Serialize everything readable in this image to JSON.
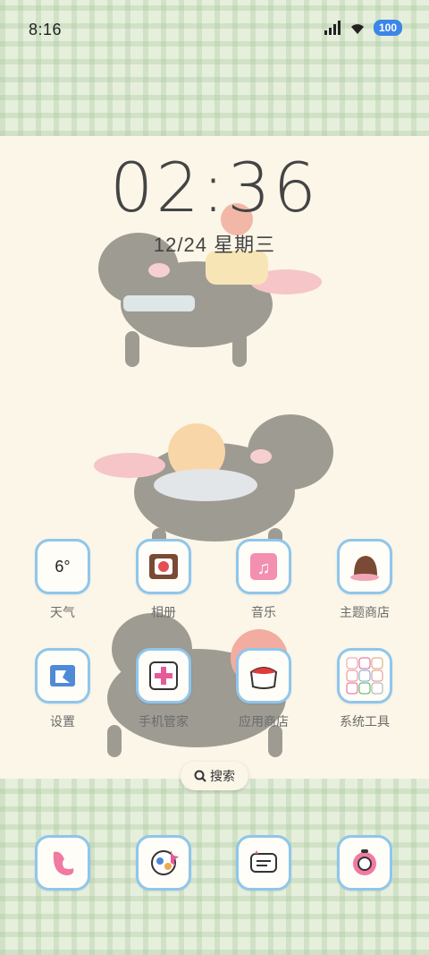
{
  "status_bar": {
    "time": "8:16",
    "battery": "100"
  },
  "clock_widget": {
    "time": "02:36",
    "date": "12/24 星期三"
  },
  "apps_row1": [
    {
      "label": "天气",
      "value": "6°",
      "icon": "weather-icon"
    },
    {
      "label": "相册",
      "icon": "gallery-icon"
    },
    {
      "label": "音乐",
      "icon": "music-icon"
    },
    {
      "label": "主题商店",
      "icon": "theme-store-icon"
    }
  ],
  "apps_row2": [
    {
      "label": "设置",
      "icon": "settings-icon"
    },
    {
      "label": "手机管家",
      "icon": "phone-manager-icon"
    },
    {
      "label": "应用商店",
      "icon": "app-store-icon"
    },
    {
      "label": "系统工具",
      "icon": "system-tools-folder-icon"
    }
  ],
  "search": {
    "label": "搜索"
  },
  "dock": [
    {
      "icon": "phone-icon"
    },
    {
      "icon": "browser-icon"
    },
    {
      "icon": "messages-icon"
    },
    {
      "icon": "camera-icon"
    }
  ],
  "colors": {
    "icon_border": "#8fc6ec",
    "battery": "#3b86e8",
    "plaid": "#e6efdc"
  }
}
